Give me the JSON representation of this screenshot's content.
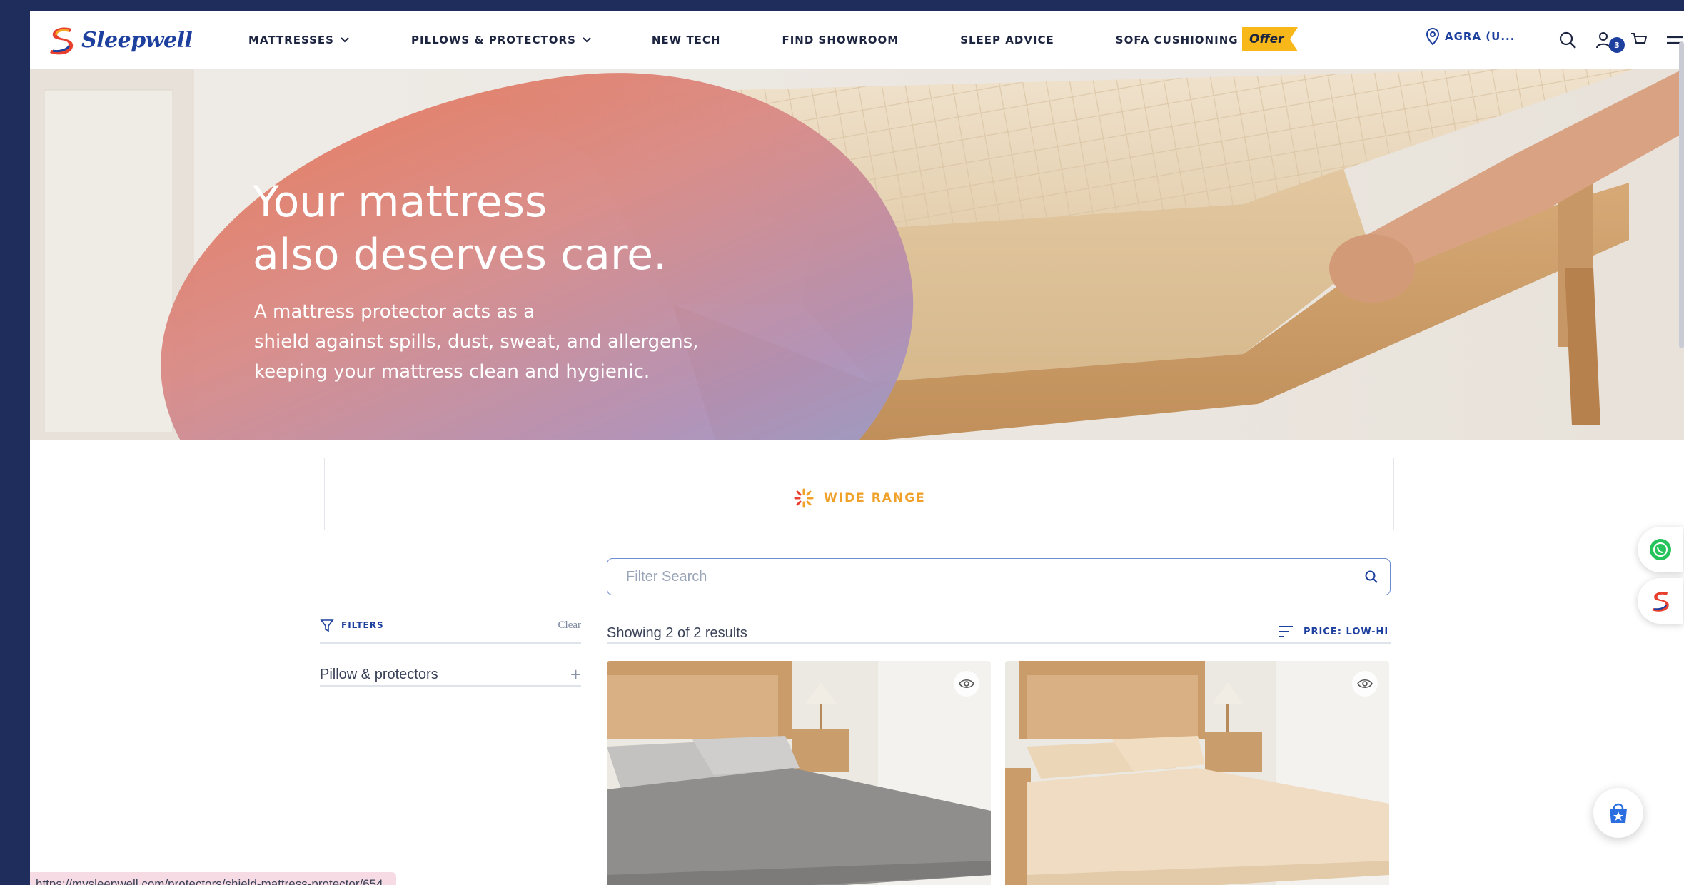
{
  "brand": {
    "name": "Sleepwell"
  },
  "nav": {
    "items": [
      {
        "label": "MATTRESSES",
        "dropdown": true
      },
      {
        "label": "PILLOWS & PROTECTORS",
        "dropdown": true
      },
      {
        "label": "NEW TECH",
        "dropdown": false
      },
      {
        "label": "FIND SHOWROOM",
        "dropdown": false
      },
      {
        "label": "SLEEP ADVICE",
        "dropdown": false
      },
      {
        "label": "SOFA CUSHIONING",
        "dropdown": true
      }
    ],
    "offer_label": "Offer",
    "location_label": "AGRA (U...",
    "cart_count": "3"
  },
  "hero": {
    "title_line1": "Your mattress",
    "title_line2": "also deserves care.",
    "sub_line1": "A mattress protector acts as a",
    "sub_line2": "shield against spills, dust, sweat, and allergens,",
    "sub_line3": "keeping your mattress clean and hygienic."
  },
  "feature": {
    "label": "WIDE RANGE"
  },
  "search": {
    "placeholder": "Filter Search",
    "value": ""
  },
  "filters": {
    "title": "FILTERS",
    "clear_label": "Clear",
    "items": [
      {
        "label": "Pillow & protectors"
      }
    ]
  },
  "results": {
    "summary": "Showing 2 of 2 results",
    "sort_label": "PRICE: LOW-HIGH"
  },
  "products": [
    {
      "image": "grey-mattress-protector-bed",
      "color": "#8d8d8d"
    },
    {
      "image": "beige-quilted-mattress-protector-bed",
      "color": "#efdcc2"
    }
  ],
  "status_bar": {
    "url": "https://mysleepwell.com/protectors/shield-mattress-protector/654"
  },
  "colors": {
    "brand_blue": "#1d3f9e",
    "accent_orange": "#f0a12a",
    "offer_yellow": "#f8b81a",
    "frame_navy": "#1f2d5c"
  }
}
